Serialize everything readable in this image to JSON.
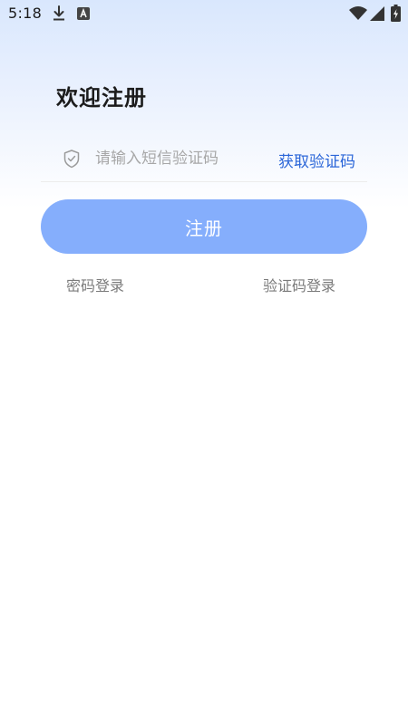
{
  "status_bar": {
    "time": "5:18",
    "icons": [
      "download-icon",
      "a-badge-icon",
      "wifi-icon",
      "signal-icon",
      "battery-charging-icon"
    ]
  },
  "page": {
    "title": "欢迎注册"
  },
  "sms": {
    "icon": "shield-check-icon",
    "placeholder": "请输入短信验证码",
    "value": "",
    "get_code_label": "获取验证码"
  },
  "register_button": {
    "label": "注册"
  },
  "links": {
    "password_login": "密码登录",
    "code_login": "验证码登录"
  },
  "colors": {
    "accent": "#2b66d8",
    "button": "#85aefc",
    "header_gradient_top": "#d9e7fd"
  }
}
